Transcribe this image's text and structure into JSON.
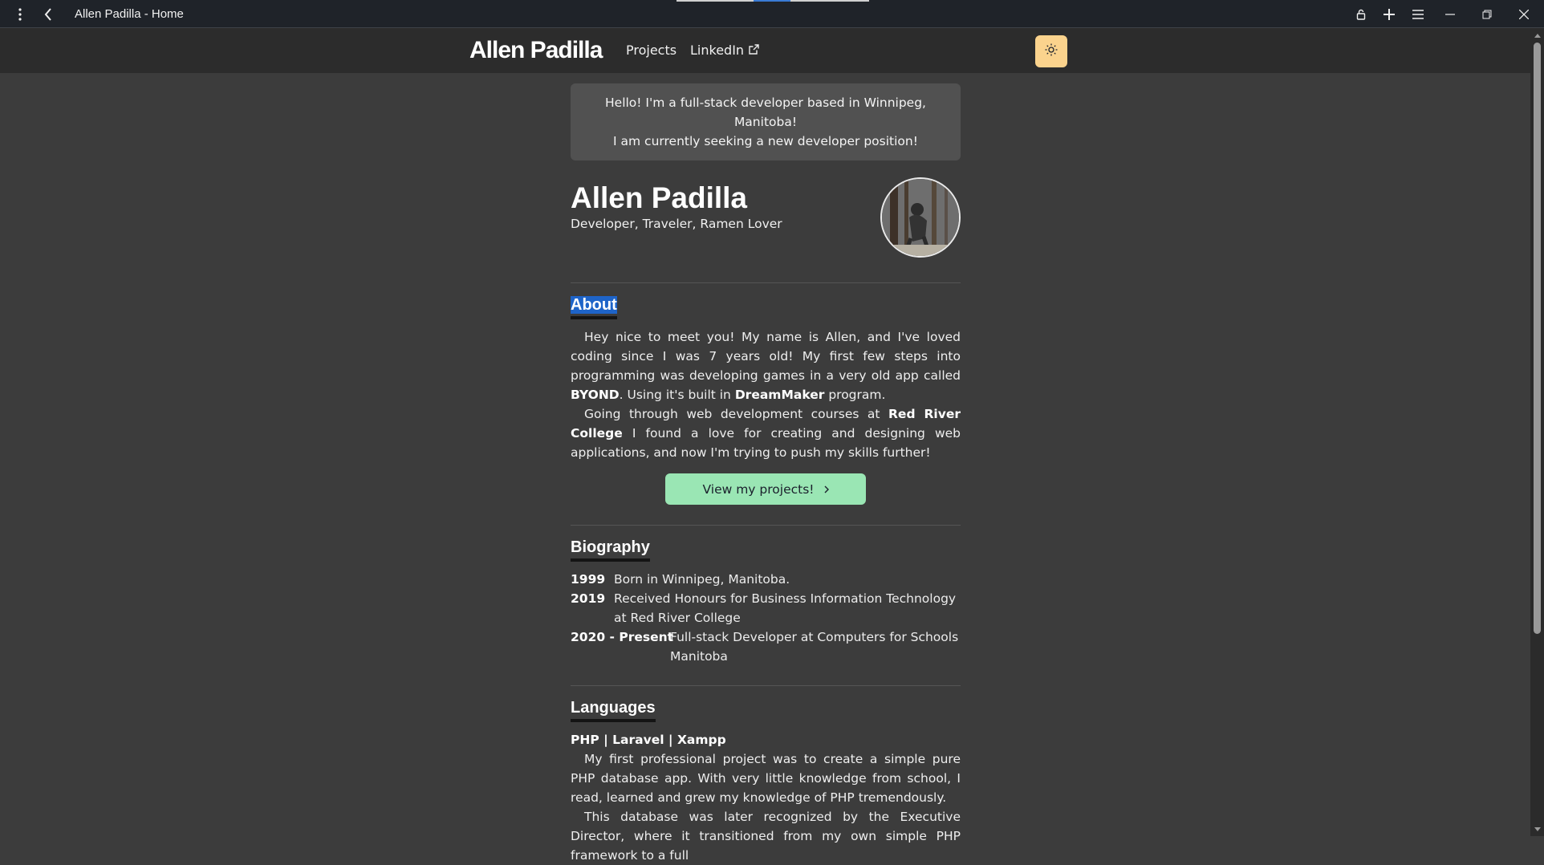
{
  "window": {
    "title": "Allen Padilla - Home"
  },
  "colors": {
    "accent_theme_button": "#fbd38d",
    "cta_button": "#9ae6b4",
    "selection": "#1e64c8"
  },
  "nav": {
    "brand": "Allen Padilla",
    "links": [
      {
        "label": "Projects"
      },
      {
        "label": "LinkedIn",
        "icon": "external-link-icon"
      }
    ],
    "theme_toggle_icon": "sun-icon"
  },
  "intro": {
    "line1": "Hello! I'm a full-stack developer based in Winnipeg, Manitoba!",
    "line2": "I am currently seeking a new developer position!"
  },
  "hero": {
    "name": "Allen Padilla",
    "subtitle": "Developer, Traveler, Ramen Lover"
  },
  "about": {
    "heading": "About",
    "p1_a": "Hey nice to meet you! My name is Allen, and I've loved coding since I was 7 years old! My first few steps into programming was developing games in a very old app called ",
    "p1_b": "BYOND",
    "p1_c": ". Using it's built in ",
    "p1_d": "DreamMaker",
    "p1_e": " program.",
    "p2_a": "Going through web development courses at ",
    "p2_b": "Red River College",
    "p2_c": " I found a love for creating and designing web applications, and now I'm trying to push my skills further!",
    "cta_label": "View my projects!",
    "cta_icon": "chevron-right-icon"
  },
  "biography": {
    "heading": "Biography",
    "entries": [
      {
        "year": "1999",
        "text": "Born in Winnipeg, Manitoba."
      },
      {
        "year": "2019",
        "text": "Received Honours for Business Information Technology at Red River College"
      },
      {
        "year": "2020 - Present",
        "text": "Full-stack Developer at Computers for Schools Manitoba"
      }
    ]
  },
  "languages": {
    "heading": "Languages",
    "title": "PHP | Laravel | Xampp",
    "p1": "My first professional project was to create a simple pure PHP database app. With very little knowledge from school, I read, learned and grew my knowledge of PHP tremendously.",
    "p2": "This database was later recognized by the Executive Director, where it transitioned from my own simple PHP framework to a full"
  }
}
